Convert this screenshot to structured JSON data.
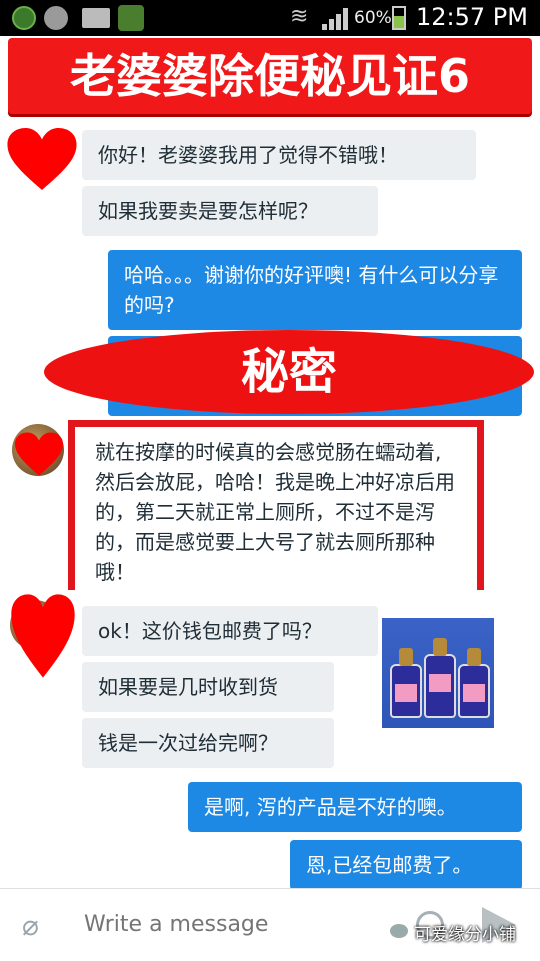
{
  "status_bar": {
    "battery_percent": "60%",
    "time": "12:57 PM"
  },
  "banner": {
    "title": "老婆婆除便秘见证6"
  },
  "overlay": {
    "secret_label": "秘密"
  },
  "messages": [
    {
      "sender": "customer",
      "text": "你好！老婆婆我用了觉得不错哦！"
    },
    {
      "sender": "customer",
      "text": "如果我要卖是要怎样呢？"
    },
    {
      "sender": "me",
      "text": "哈哈。。。谢谢你的好评噢! 有什么可以分享的吗?"
    },
    {
      "sender": "customer",
      "text": "就在按摩的时候真的会感觉肠在蠕动着,然后会放屁，哈哈！我是晚上冲好凉后用的，第二天就正常上厕所，不过不是泻的，而是感觉要上大号了就去厕所那种哦！"
    },
    {
      "sender": "customer",
      "text": "ok！这价钱包邮费了吗？"
    },
    {
      "sender": "customer",
      "text": "如果要是几时收到货"
    },
    {
      "sender": "customer",
      "text": "钱是一次过给完啊？"
    },
    {
      "sender": "me",
      "text": "是啊, 泻的产品是不好的噢。"
    },
    {
      "sender": "me",
      "text": "恩,已经包邮费了。"
    }
  ],
  "composer": {
    "placeholder": "Write a message"
  },
  "watermark": {
    "text": "可爱缘分小铺"
  },
  "colors": {
    "banner_red": "#f01818",
    "outgoing_blue": "#1e88e5",
    "incoming_gray": "#eceff1",
    "highlight_red": "#e0161c"
  },
  "icons": [
    "attach-icon",
    "emoji-icon",
    "send-icon",
    "wifi-icon",
    "signal-icon",
    "battery-icon",
    "heart-icon"
  ]
}
